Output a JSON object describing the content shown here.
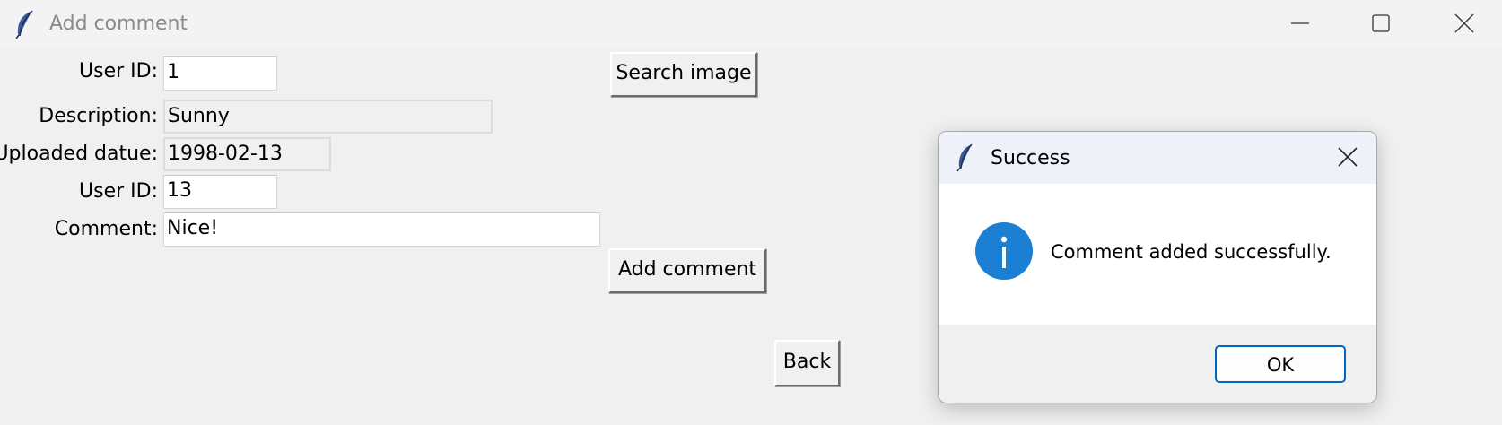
{
  "window": {
    "title": "Add comment"
  },
  "form": {
    "user_id_label": "User ID:",
    "user_id_value": "1",
    "description_label": "Description:",
    "description_value": "Sunny",
    "uploaded_label": "Uploaded datue:",
    "uploaded_value": "1998-02-13",
    "comment_user_id_label": "User ID:",
    "comment_user_id_value": "13",
    "comment_label": "Comment:",
    "comment_value": "Nice!"
  },
  "buttons": {
    "search_image": "Search image",
    "add_comment": "Add comment",
    "back": "Back"
  },
  "dialog": {
    "title": "Success",
    "message": "Comment added successfully.",
    "ok_label": "OK"
  },
  "icons": {
    "app": "feather-icon",
    "info": "info-icon",
    "minimize": "minimize-icon",
    "maximize": "maximize-icon",
    "close": "close-icon"
  },
  "colors": {
    "info_icon": "#1b7fd4",
    "ok_border": "#0067c0"
  }
}
